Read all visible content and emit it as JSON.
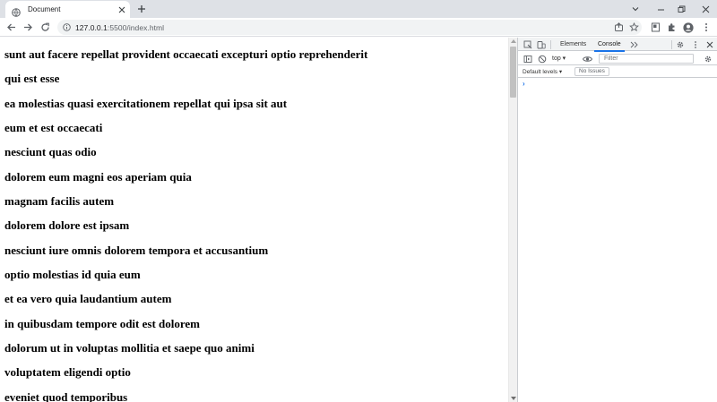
{
  "tab": {
    "title": "Document",
    "favicon": "globe-icon"
  },
  "toolbar": {
    "url_host": "127.0.0.1",
    "url_rest": ":5500/index.html",
    "lock_icon": "info-icon"
  },
  "page": {
    "headings": [
      "sunt aut facere repellat provident occaecati excepturi optio reprehenderit",
      "qui est esse",
      "ea molestias quasi exercitationem repellat qui ipsa sit aut",
      "eum et est occaecati",
      "nesciunt quas odio",
      "dolorem eum magni eos aperiam quia",
      "magnam facilis autem",
      "dolorem dolore est ipsam",
      "nesciunt iure omnis dolorem tempora et accusantium",
      "optio molestias id quia eum",
      "et ea vero quia laudantium autem",
      "in quibusdam tempore odit est dolorem",
      "dolorum ut in voluptas mollitia et saepe quo animi",
      "voluptatem eligendi optio",
      "eveniet quod temporibus"
    ]
  },
  "devtools": {
    "tabs": [
      "Elements",
      "Console"
    ],
    "active_tab": "Console",
    "context": "top",
    "filter_placeholder": "Filter",
    "levels": "Default levels",
    "issues": "No Issues",
    "prompt": "›"
  },
  "colors": {
    "accent": "#1a73e8",
    "chrome_bg": "#dee1e6"
  }
}
